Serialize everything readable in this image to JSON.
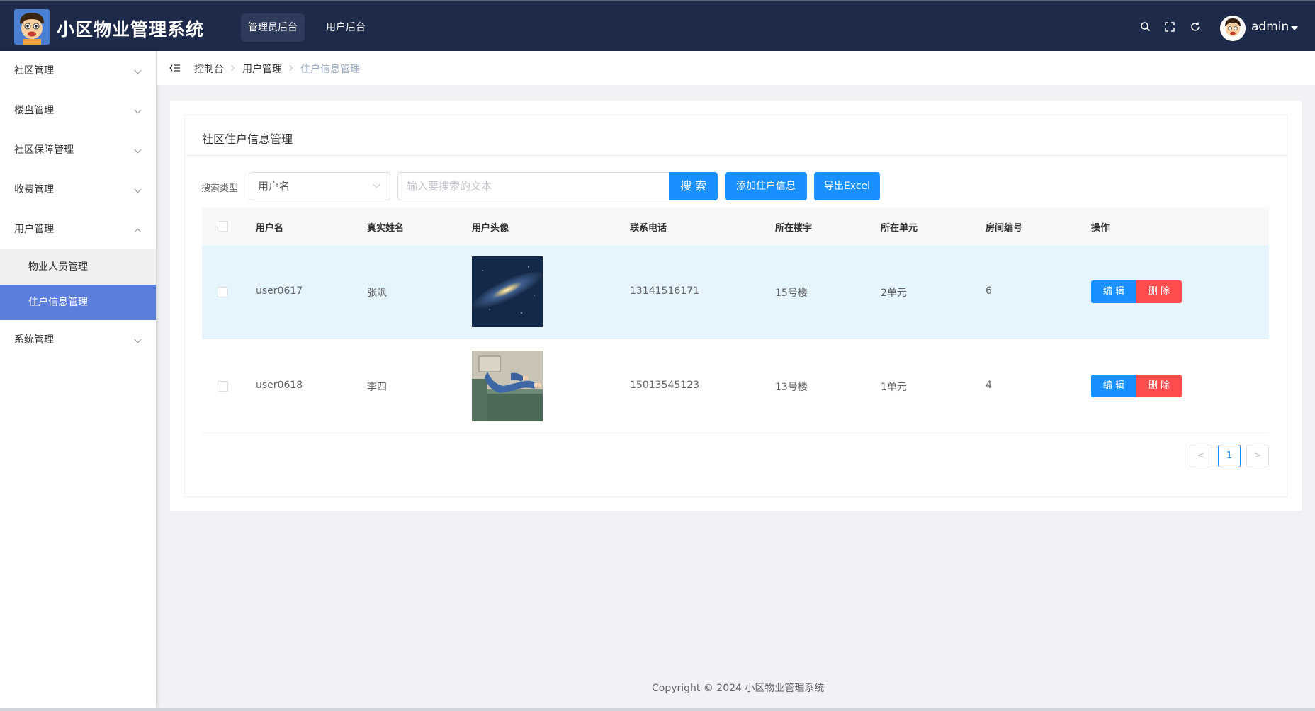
{
  "header": {
    "brand": "小区物业管理系统",
    "nav": [
      "管理员后台",
      "用户后台"
    ],
    "icons": [
      "search-icon",
      "fullscreen-icon",
      "refresh-icon"
    ],
    "username": "admin"
  },
  "sidebar": {
    "items": [
      {
        "label": "社区管理"
      },
      {
        "label": "楼盘管理"
      },
      {
        "label": "社区保障管理"
      },
      {
        "label": "收费管理"
      },
      {
        "label": "用户管理"
      },
      {
        "label": "系统管理"
      }
    ],
    "subitems": [
      {
        "label": "物业人员管理"
      },
      {
        "label": "住户信息管理"
      }
    ]
  },
  "breadcrumb": [
    "控制台",
    "用户管理",
    "住户信息管理"
  ],
  "card": {
    "title": "社区住户信息管理",
    "search_label": "搜索类型",
    "select_value": "用户名",
    "search_placeholder": "输入要搜索的文本",
    "search_button": "搜 索",
    "add_button": "添加住户信息",
    "export_button": "导出Excel"
  },
  "table": {
    "columns": [
      "用户名",
      "真实姓名",
      "用户头像",
      "联系电话",
      "所在楼宇",
      "所在单元",
      "房间编号",
      "操作"
    ],
    "rows": [
      {
        "username": "user0617",
        "realname": "张飒",
        "phone": "13141516171",
        "building": "15号楼",
        "unit": "2单元",
        "room": "6"
      },
      {
        "username": "user0618",
        "realname": "李四",
        "phone": "15013545123",
        "building": "13号楼",
        "unit": "1单元",
        "room": "4"
      }
    ],
    "edit_label": "编 辑",
    "delete_label": "删 除"
  },
  "pagination": {
    "prev": "<",
    "current": "1",
    "next": ">"
  },
  "footer": {
    "copyright": "Copyright © 2024 小区物业管理系统"
  },
  "colors": {
    "header_bg": "#1e2a4a",
    "primary": "#1890ff",
    "danger": "#ff4d4f",
    "active_menu": "#5b7ddc"
  }
}
